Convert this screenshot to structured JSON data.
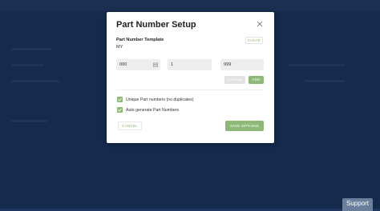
{
  "modal": {
    "title": "Part Number Setup",
    "template_label": "Part Number Template",
    "template_value": "MY",
    "clear_label": "CLEAR",
    "fields": {
      "prefix_value": "000",
      "start_value": "1",
      "end_value": "999"
    },
    "cancel_small_label": "CANCEL",
    "add_label": "ADD",
    "options": [
      {
        "label": "Unique Part numbers (no duplicates)",
        "checked": true
      },
      {
        "label": "Auto generate Part Numbers",
        "checked": true
      }
    ],
    "cancel_label": "CANCEL",
    "save_label": "SAVE OPTIONS"
  },
  "support_label": "Support",
  "colors": {
    "background": "#1d365f",
    "accent": "#8db878",
    "muted_button": "#e2e2e2"
  },
  "icons": [
    "close-icon",
    "calendar-icon",
    "checkmark-icon"
  ]
}
